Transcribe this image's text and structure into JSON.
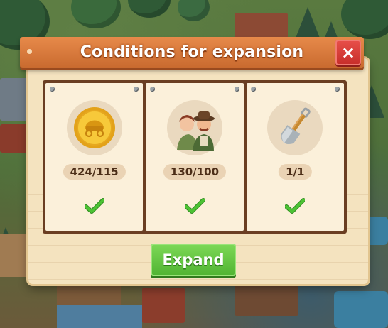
{
  "dialog": {
    "title": "Conditions for expansion",
    "close_label": "×"
  },
  "conditions": [
    {
      "icon": "gold-coin-wagon-icon",
      "count": "424/115",
      "met": true
    },
    {
      "icon": "farmers-couple-icon",
      "count": "130/100",
      "met": true
    },
    {
      "icon": "shovel-icon",
      "count": "1/1",
      "met": true
    }
  ],
  "actions": {
    "expand_label": "Expand"
  },
  "colors": {
    "title_bar": "#d8773a",
    "close_button": "#d93c36",
    "expand_button": "#5fc23f",
    "check": "#3fae2a",
    "card_bg": "#fbf0da",
    "panel_bg": "#f4e3bf"
  }
}
